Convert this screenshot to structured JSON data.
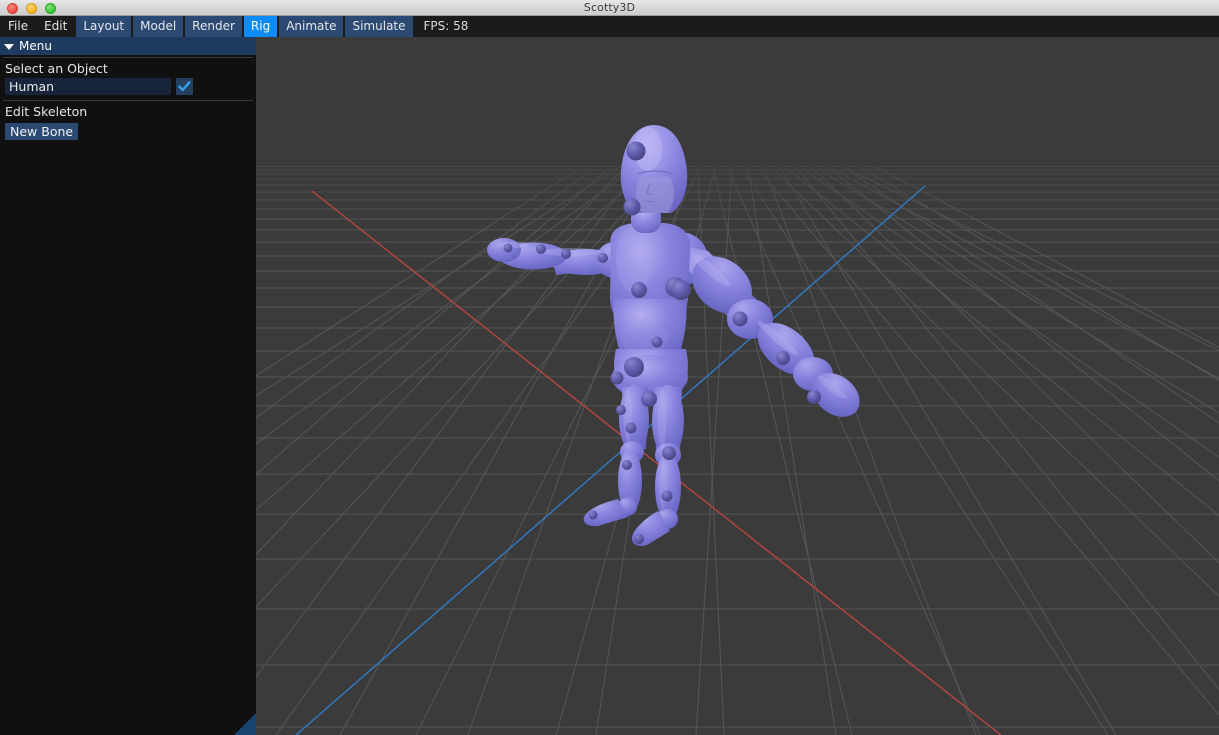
{
  "window": {
    "title": "Scotty3D",
    "traffic_lights": [
      "close-button",
      "minimize-button",
      "maximize-button"
    ]
  },
  "menubar": {
    "items": [
      {
        "label": "File",
        "style": "plain",
        "active": false
      },
      {
        "label": "Edit",
        "style": "plain",
        "active": false
      },
      {
        "label": "Layout",
        "style": "button",
        "active": false
      },
      {
        "label": "Model",
        "style": "button",
        "active": false
      },
      {
        "label": "Render",
        "style": "button",
        "active": false
      },
      {
        "label": "Rig",
        "style": "button",
        "active": true
      },
      {
        "label": "Animate",
        "style": "button",
        "active": false
      },
      {
        "label": "Simulate",
        "style": "button",
        "active": false
      }
    ],
    "fps_label": "FPS: 58",
    "active_accent": "#0c8cfb",
    "button_bg": "#2b4a73"
  },
  "sidebar": {
    "panel_title": "Menu",
    "collapse_icon": "caret-down-icon",
    "select_object": {
      "label": "Select an Object",
      "value": "Human",
      "placeholder": "Human",
      "checkbox_checked": true,
      "checkbox_icon": "checkmark-icon"
    },
    "edit_skeleton": {
      "label": "Edit Skeleton",
      "new_bone_label": "New Bone"
    },
    "resize_grip_color": "#1b4370"
  },
  "viewport": {
    "background": "#3b3b3b",
    "grid_color": "#555555",
    "axis_x_color": "#c44a4a",
    "axis_z_color": "#2f7fd0",
    "model": {
      "name": "Human",
      "surface_color": "#7b77d6",
      "highlight_color": "#a5a1ea",
      "joint_color": "#5a57a8",
      "joint_count": 24
    }
  }
}
